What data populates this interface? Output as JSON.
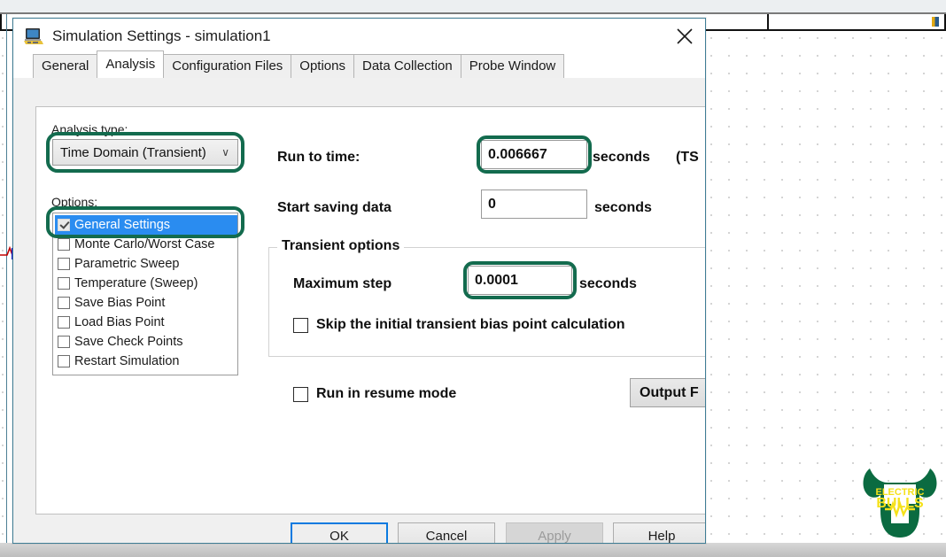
{
  "background": {
    "canvas_name": "schematic-canvas",
    "grid": "dot-grid"
  },
  "watermark": {
    "line1": "ELECTRIC",
    "line2": "BULLS",
    "color_green": "#0b6b41",
    "color_yellow": "#f5e11a"
  },
  "dialog": {
    "title": "Simulation Settings - simulation1",
    "icon": "simulation-profile-icon",
    "close_label": "✕",
    "tabs": [
      {
        "label": "General",
        "active": false
      },
      {
        "label": "Analysis",
        "active": true
      },
      {
        "label": "Configuration Files",
        "active": false
      },
      {
        "label": "Options",
        "active": false
      },
      {
        "label": "Data Collection",
        "active": false
      },
      {
        "label": "Probe Window",
        "active": false
      }
    ],
    "analysis": {
      "analysis_type_label": "Analysis type:",
      "analysis_type_value": "Time Domain (Transient)",
      "chevron": "∨",
      "options_label": "Options:",
      "options": [
        {
          "label": "General Settings",
          "checked": true,
          "selected": true
        },
        {
          "label": "Monte Carlo/Worst Case",
          "checked": false,
          "selected": false
        },
        {
          "label": "Parametric Sweep",
          "checked": false,
          "selected": false
        },
        {
          "label": "Temperature (Sweep)",
          "checked": false,
          "selected": false
        },
        {
          "label": "Save Bias Point",
          "checked": false,
          "selected": false
        },
        {
          "label": "Load Bias Point",
          "checked": false,
          "selected": false
        },
        {
          "label": "Save Check Points",
          "checked": false,
          "selected": false
        },
        {
          "label": "Restart Simulation",
          "checked": false,
          "selected": false
        }
      ],
      "run_to_time_label": "Run to time:",
      "run_to_time_value": "0.006667",
      "run_to_time_unit": "seconds",
      "run_to_time_extra": "(TS",
      "start_saving_label": "Start saving data",
      "start_saving_value": "0",
      "start_saving_unit": "seconds",
      "transient_legend": "Transient options",
      "max_step_label": "Maximum step",
      "max_step_value": "0.0001",
      "max_step_unit": "seconds",
      "skip_bias_label": "Skip the initial transient bias point calculation",
      "skip_bias_checked": false,
      "resume_mode_label": "Run in resume mode",
      "resume_mode_checked": false,
      "output_button_label": "Output F"
    },
    "footer": {
      "ok": "OK",
      "cancel": "Cancel",
      "apply": "Apply",
      "help": "Help"
    },
    "annotation_color": "#136b4e"
  }
}
